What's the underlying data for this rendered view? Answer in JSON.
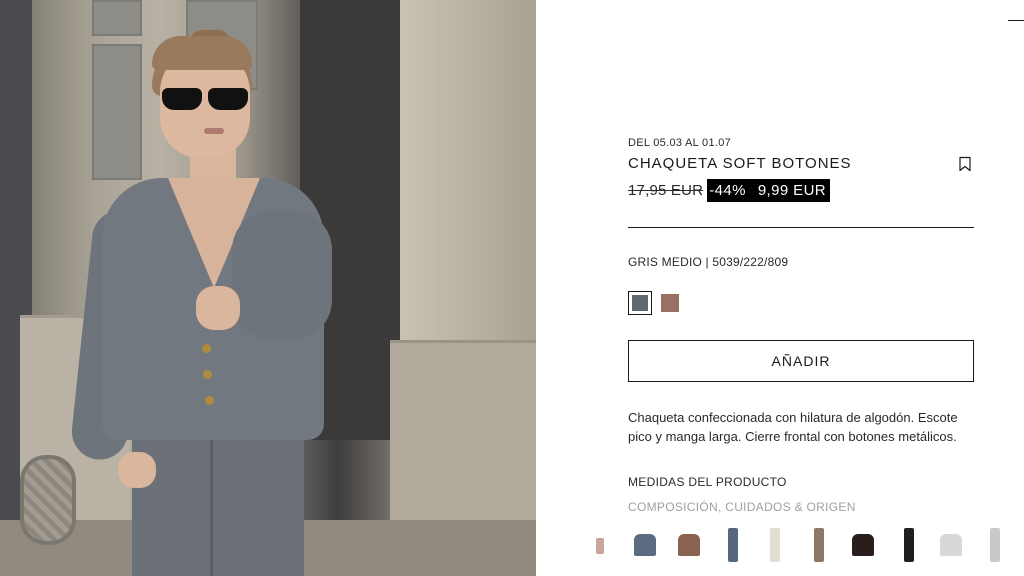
{
  "product": {
    "date_range": "DEL 05.03 AL 01.07",
    "title": "CHAQUETA SOFT BOTONES",
    "old_price": "17,95 EUR",
    "discount": "-44%",
    "new_price": "9,99 EUR",
    "color_ref": "GRIS MEDIO | 5039/222/809",
    "add_button": "AÑADIR",
    "description": "Chaqueta confeccionada con hilatura de algodón. Escote pico y manga larga. Cierre frontal con botones metálicos.",
    "measures_link": "MEDIDAS DEL PRODUCTO",
    "composition_link": "COMPOSICIÓN, CUIDADOS & ORIGEN"
  },
  "swatches": [
    {
      "name": "gris medio",
      "color": "#5f6870",
      "selected": true
    },
    {
      "name": "marron",
      "color": "#9a7064",
      "selected": false
    }
  ],
  "thumbnails": [
    {
      "icon": "bottle-thumb",
      "color": "#c9a49a"
    },
    {
      "icon": "jacket-thumb",
      "color": "#5d6b82"
    },
    {
      "icon": "jacket-thumb",
      "color": "#8a6350"
    },
    {
      "icon": "jeans-thumb",
      "color": "#56677e"
    },
    {
      "icon": "trousers-thumb",
      "color": "#e4ddd3"
    },
    {
      "icon": "trousers-thumb",
      "color": "#8e7765"
    },
    {
      "icon": "top-thumb",
      "color": "#2a1e1c"
    },
    {
      "icon": "trousers-thumb",
      "color": "#1f1f22"
    },
    {
      "icon": "sweater-thumb",
      "color": "#d8d8d8"
    },
    {
      "icon": "trousers-thumb",
      "color": "#c9c9c9"
    }
  ],
  "icons": {
    "bookmark": "bookmark-icon",
    "menu": "menu-line-icon"
  }
}
